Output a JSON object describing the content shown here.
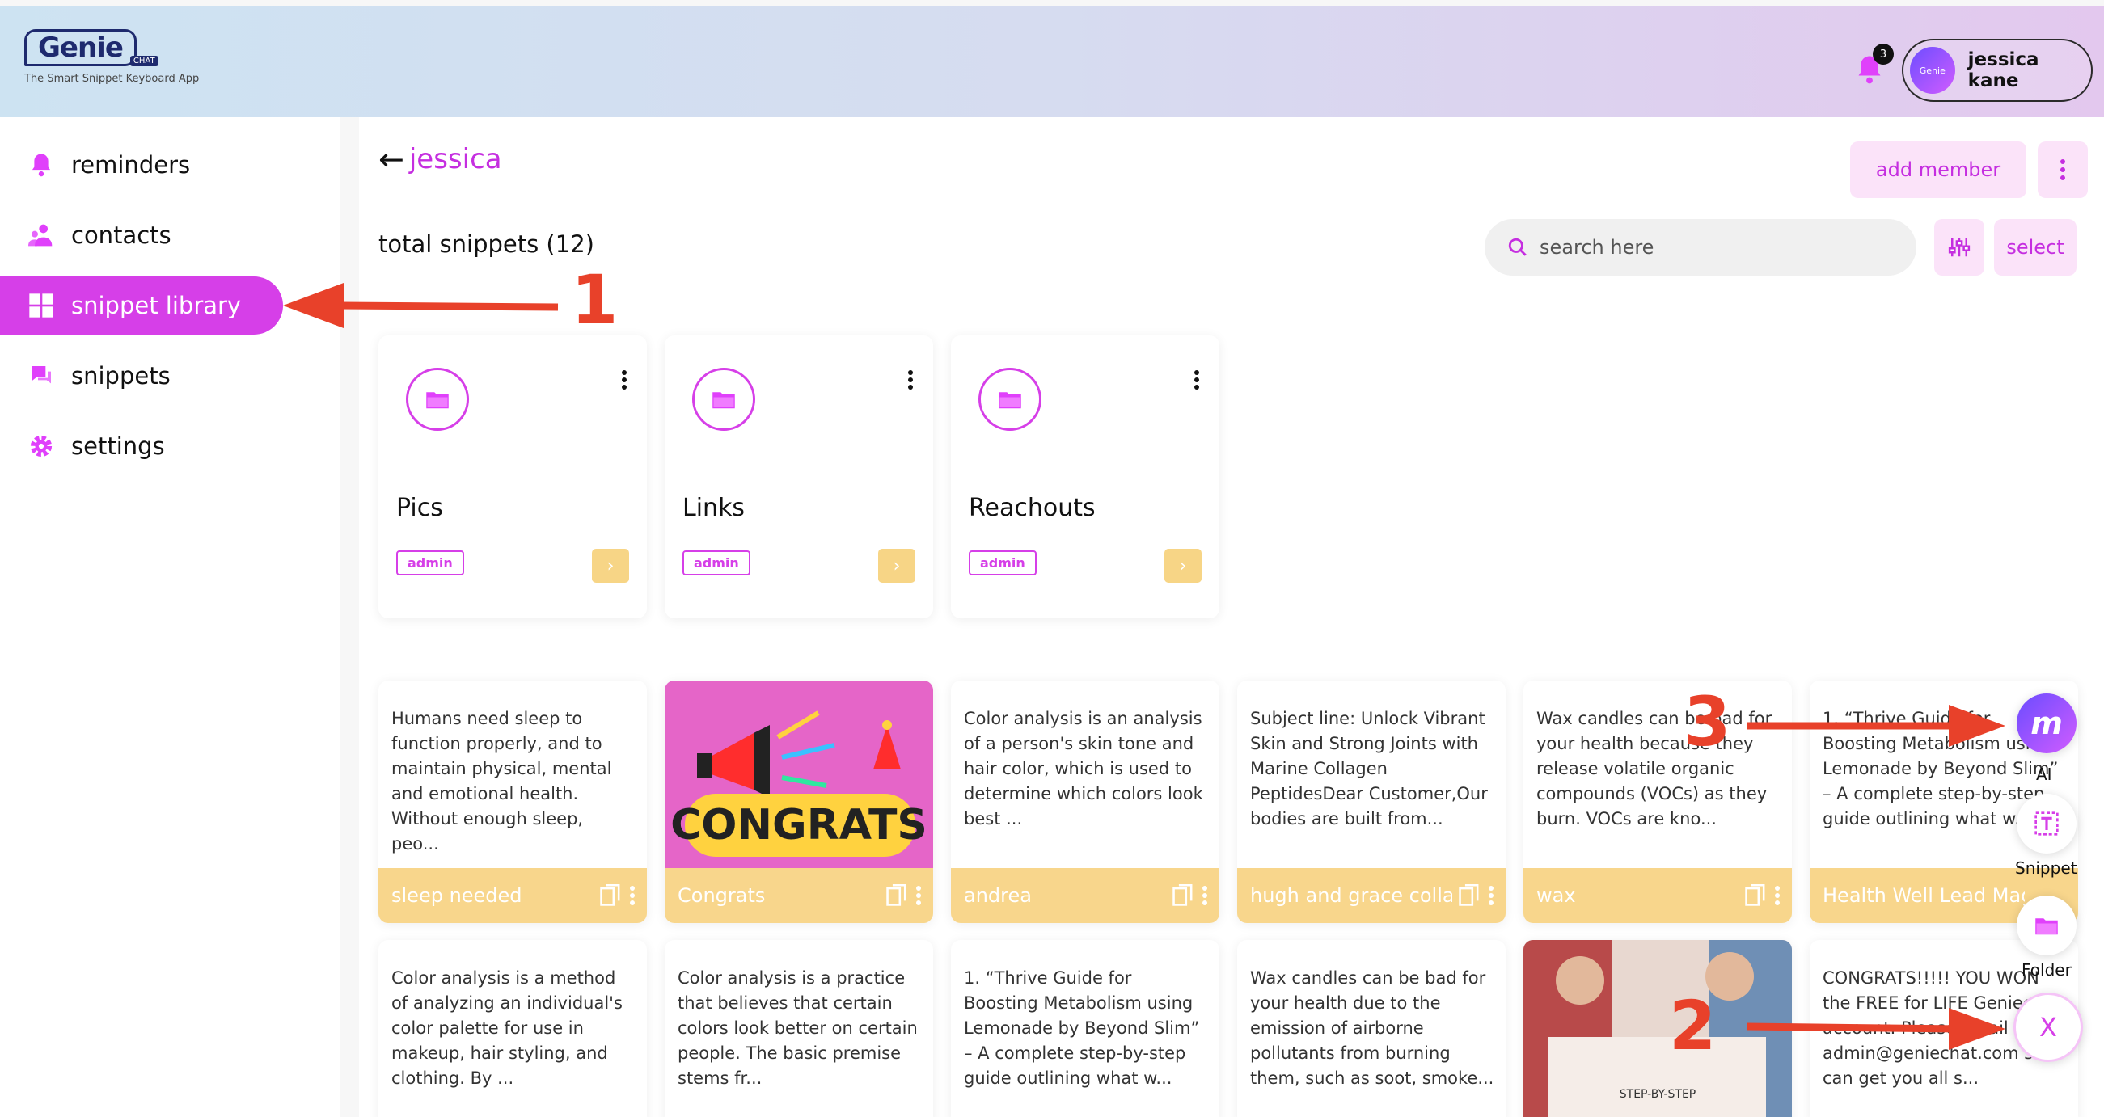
{
  "app": {
    "logo_word": "Genie",
    "logo_chat": "CHAT",
    "tagline": "The Smart Snippet Keyboard App"
  },
  "header": {
    "notification_count": "3",
    "user_avatar_text": "Genie",
    "user_name": "jessica kane"
  },
  "sidebar": {
    "items": [
      {
        "label": "reminders",
        "icon": "bell-icon"
      },
      {
        "label": "contacts",
        "icon": "users-icon"
      },
      {
        "label": "snippet library",
        "icon": "grid-icon",
        "active": true
      },
      {
        "label": "snippets",
        "icon": "chat-icon"
      },
      {
        "label": "settings",
        "icon": "gear-icon"
      }
    ]
  },
  "main": {
    "back_title": "jessica",
    "add_member_label": "add member",
    "total_label": "total snippets (12)",
    "search_placeholder": "search here",
    "select_label": "select",
    "folders": [
      {
        "name": "Pics",
        "tag": "admin"
      },
      {
        "name": "Links",
        "tag": "admin"
      },
      {
        "name": "Reachouts",
        "tag": "admin"
      }
    ],
    "snippets_row1": [
      {
        "text": "Humans need sleep to function properly, and to maintain physical, mental and emotional health. Without enough sleep, peo...",
        "title": "sleep needed"
      },
      {
        "image": "congrats",
        "title": "Congrats"
      },
      {
        "text": "Color analysis is an analysis of a person's skin tone and hair color, which is used to determine which colors look best ...",
        "title": "andrea"
      },
      {
        "text": "Subject line: Unlock Vibrant Skin and Strong Joints with Marine Collagen PeptidesDear Customer,Our bodies are built from...",
        "title": "hugh and grace colla"
      },
      {
        "text": "Wax candles can be bad for your health because they release volatile organic compounds (VOCs) as they burn. VOCs are kno...",
        "title": "wax"
      },
      {
        "text": "1. “Thrive Guide for Boosting Metabolism using Lemonade by Beyond Slim” – A complete step-by-step guide outlining what w...",
        "title": "Health Well Lead Mag"
      }
    ],
    "snippets_row2": [
      {
        "text": "Color analysis is a method of analyzing an individual's color palette for use in makeup, hair styling, and clothing. By ..."
      },
      {
        "text": "Color analysis is a practice that believes that certain colors look better on certain people. The basic premise stems fr..."
      },
      {
        "text": "1. “Thrive Guide for Boosting Metabolism using Lemonade by Beyond Slim” – A complete step-by-step guide outlining what w..."
      },
      {
        "text": "Wax candles can be bad for your health due to the emission of airborne pollutants from burning them, such as soot, smoke..."
      },
      {
        "image": "photo",
        "caption": "STEP-BY-STEP"
      },
      {
        "text": "CONGRATS!!!!! YOU WON the FREE for LIFE Geniechat account. Please email admin@geniechat.com so I can get you all s..."
      }
    ],
    "image_text": {
      "congrats": "CONGRATS"
    }
  },
  "fabs": {
    "ai_label": "AI",
    "snippet_label": "Snippet",
    "folder_label": "Folder",
    "close_label": "X"
  },
  "annotations": {
    "n1": "1",
    "n2": "2",
    "n3": "3"
  },
  "colors": {
    "accent": "#d63fe8",
    "folder_footer": "#f8d68c",
    "arrow": "#e8412a"
  }
}
